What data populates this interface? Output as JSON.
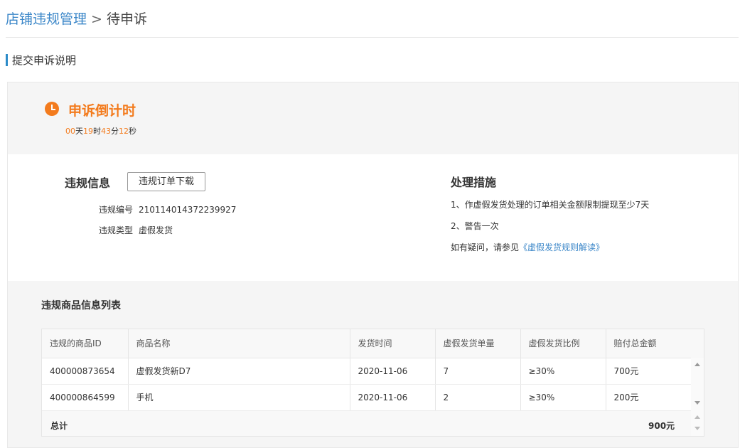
{
  "breadcrumb": {
    "parent": "店铺违规管理",
    "separator": ">",
    "current": "待申诉"
  },
  "section_title": "提交申诉说明",
  "countdown": {
    "title": "申诉倒计时",
    "days": "00",
    "days_unit": "天",
    "hours": "19",
    "hours_unit": "时",
    "minutes": "43",
    "minutes_unit": "分",
    "seconds": "12",
    "seconds_unit": "秒"
  },
  "violation_info": {
    "heading": "违规信息",
    "download_button": "违规订单下载",
    "id_label": "违规编号",
    "id_value": "210114014372239927",
    "type_label": "违规类型",
    "type_value": "虚假发货"
  },
  "measures": {
    "heading": "处理措施",
    "item1": "1、作虚假发货处理的订单相关金额限制提现至少7天",
    "item2": "2、警告一次",
    "help_prefix": "如有疑问，请参见",
    "help_link": "《虚假发货规则解读》"
  },
  "product_list": {
    "title": "违规商品信息列表",
    "columns": [
      "违规的商品ID",
      "商品名称",
      "发货时间",
      "虚假发货单量",
      "虚假发货比例",
      "赔付总金额"
    ],
    "rows": [
      [
        "400000873654",
        "虚假发货新D7",
        "2020-11-06",
        "7",
        "≥30%",
        "700元"
      ],
      [
        "400000864599",
        "手机",
        "2020-11-06",
        "2",
        "≥30%",
        "200元"
      ]
    ],
    "total_label": "总计",
    "total_value": "900元"
  }
}
